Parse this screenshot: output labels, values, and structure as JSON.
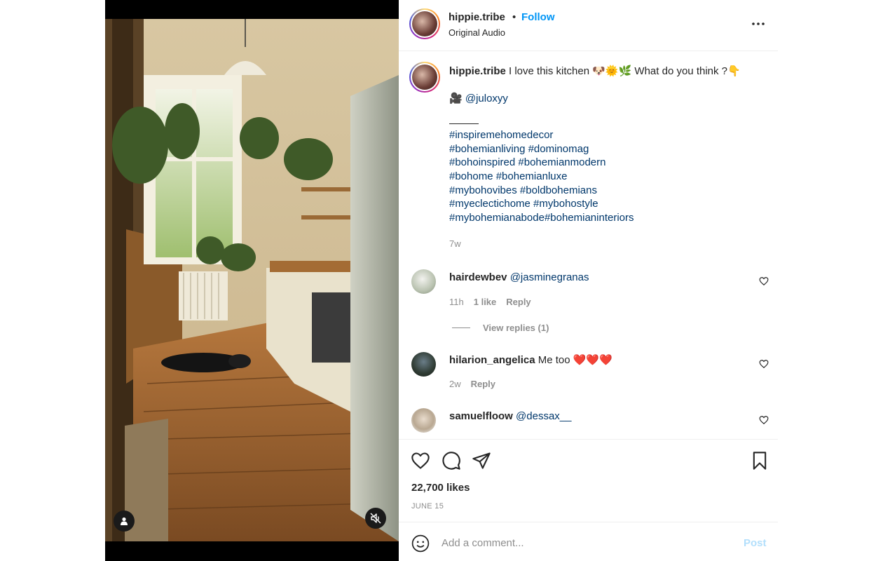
{
  "post": {
    "username": "hippie.tribe",
    "separator": "•",
    "follow_label": "Follow",
    "audio_label": "Original Audio",
    "more_icon": "more-horizontal-icon"
  },
  "caption": {
    "username": "hippie.tribe",
    "text": "I love this kitchen 🐶🌞🌿 What do you think ?👇",
    "credit_prefix": "🎥 ",
    "credit_handle": "@juloxyy",
    "hashtag_lines": [
      "#inspiremehomedecor",
      "#bohemianliving #dominomag",
      "#bohoinspired #bohemianmodern",
      "#bohome #bohemianluxe",
      "#mybohovibes #boldbohemians",
      "#myeclectichome #mybohostyle",
      "#mybohemianabode#bohemianinteriors"
    ],
    "age": "7w"
  },
  "comments": [
    {
      "username": "hairdewbev",
      "text": "",
      "mention": "@jasminegranas",
      "time": "11h",
      "likes": "1 like",
      "reply": "Reply"
    },
    {
      "username": "hilarion_angelica",
      "text": "Me too ❤️❤️❤️",
      "mention": "",
      "time": "2w",
      "likes": "",
      "reply": "Reply"
    },
    {
      "username": "samuelfloow",
      "text": "",
      "mention": "@dessax__"
    }
  ],
  "view_replies": "View replies (1)",
  "likes_count": "22,700 likes",
  "date": "JUNE 15",
  "add_comment": {
    "placeholder": "Add a comment...",
    "post_label": "Post"
  },
  "colors": {
    "link": "#00376b",
    "follow": "#0095f6",
    "post_disabled": "#b2dffc",
    "muted": "#8e8e8e"
  }
}
